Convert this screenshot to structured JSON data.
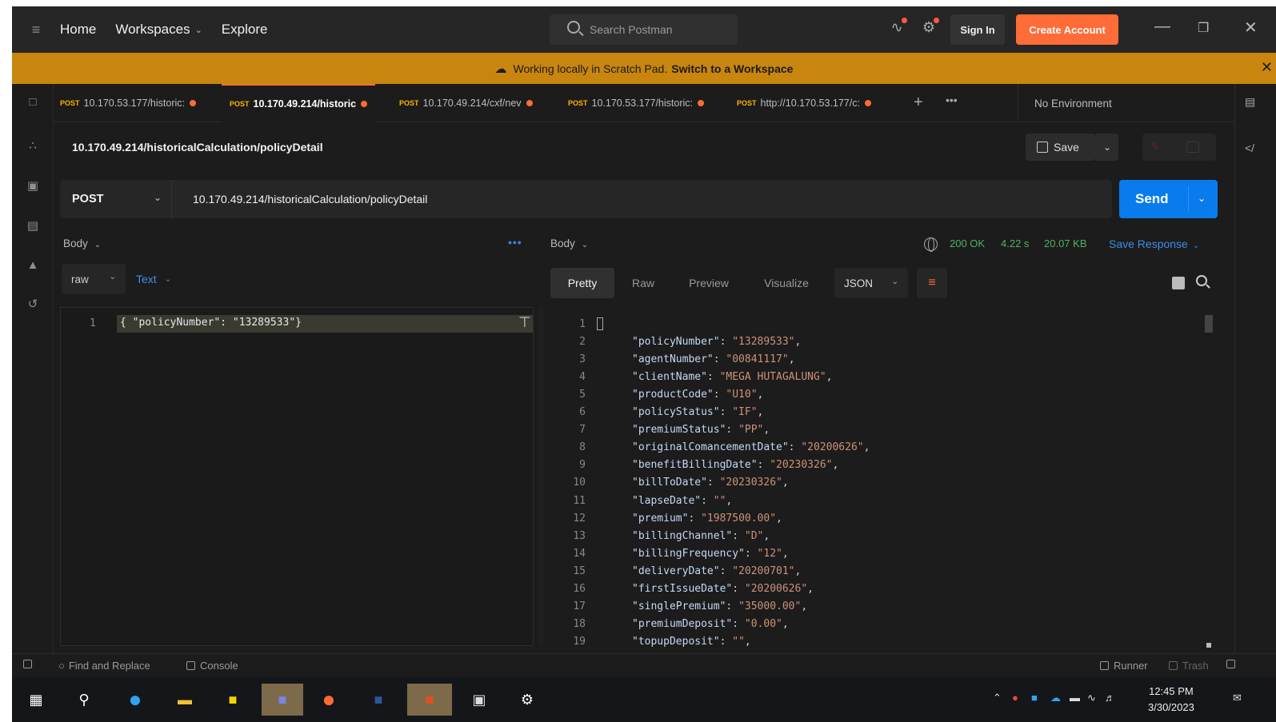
{
  "topbar": {
    "home": "Home",
    "workspaces": "Workspaces",
    "explore": "Explore",
    "search_placeholder": "Search Postman",
    "sign_in": "Sign In",
    "create_account": "Create Account"
  },
  "banner": {
    "text": "Working locally in Scratch Pad.",
    "link": "Switch to a Workspace"
  },
  "tabs": [
    {
      "method": "POST",
      "url": "10.170.53.177/historic:"
    },
    {
      "method": "POST",
      "url": "10.170.49.214/historic"
    },
    {
      "method": "POST",
      "url": "10.170.49.214/cxf/nev"
    },
    {
      "method": "POST",
      "url": "10.170.53.177/historic:"
    },
    {
      "method": "POST",
      "url": "http://10.170.53.177/c:"
    }
  ],
  "environment": "No Environment",
  "request": {
    "title": "10.170.49.214/historicalCalculation/policyDetail",
    "save": "Save",
    "method": "POST",
    "url": "10.170.49.214/historicalCalculation/policyDetail",
    "send": "Send",
    "body_label": "Body",
    "raw": "raw",
    "text": "Text",
    "line_no": "1",
    "body_code": "{ \"policyNumber\": \"13289533\"}"
  },
  "response": {
    "body_label": "Body",
    "status": "200 OK",
    "time": "4.22 s",
    "size": "20.07 KB",
    "save_response": "Save Response",
    "tabs": [
      "Pretty",
      "Raw",
      "Preview",
      "Visualize"
    ],
    "format": "JSON",
    "lines": [
      {
        "n": "1",
        "k": "",
        "v": ""
      },
      {
        "n": "2",
        "k": "\"policyNumber\"",
        "v": "\"13289533\""
      },
      {
        "n": "3",
        "k": "\"agentNumber\"",
        "v": "\"00841117\""
      },
      {
        "n": "4",
        "k": "\"clientName\"",
        "v": "\"MEGA HUTAGALUNG\""
      },
      {
        "n": "5",
        "k": "\"productCode\"",
        "v": "\"U10\""
      },
      {
        "n": "6",
        "k": "\"policyStatus\"",
        "v": "\"IF\""
      },
      {
        "n": "7",
        "k": "\"premiumStatus\"",
        "v": "\"PP\""
      },
      {
        "n": "8",
        "k": "\"originalComancementDate\"",
        "v": "\"20200626\""
      },
      {
        "n": "9",
        "k": "\"benefitBillingDate\"",
        "v": "\"20230326\""
      },
      {
        "n": "10",
        "k": "\"billToDate\"",
        "v": "\"20230326\""
      },
      {
        "n": "11",
        "k": "\"lapseDate\"",
        "v": "\"\""
      },
      {
        "n": "12",
        "k": "\"premium\"",
        "v": "\"1987500.00\""
      },
      {
        "n": "13",
        "k": "\"billingChannel\"",
        "v": "\"D\""
      },
      {
        "n": "14",
        "k": "\"billingFrequency\"",
        "v": "\"12\""
      },
      {
        "n": "15",
        "k": "\"deliveryDate\"",
        "v": "\"20200701\""
      },
      {
        "n": "16",
        "k": "\"firstIssueDate\"",
        "v": "\"20200626\""
      },
      {
        "n": "17",
        "k": "\"singlePremium\"",
        "v": "\"35000.00\""
      },
      {
        "n": "18",
        "k": "\"premiumDeposit\"",
        "v": "\"0.00\""
      },
      {
        "n": "19",
        "k": "\"topupDeposit\"",
        "v": "\"\""
      }
    ]
  },
  "footer": {
    "find_replace": "Find and Replace",
    "console": "Console",
    "runner": "Runner",
    "trash": "Trash"
  },
  "taskbar": {
    "time": "12:45 PM",
    "date": "3/30/2023"
  }
}
